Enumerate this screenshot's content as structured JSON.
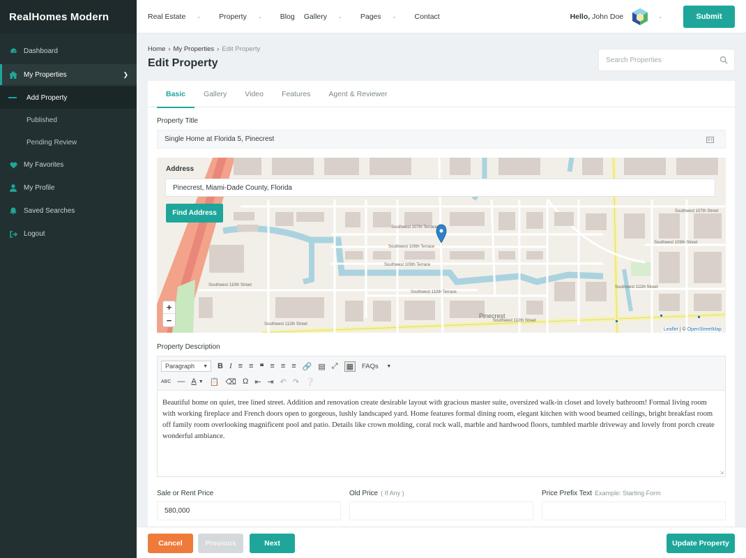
{
  "brand": "RealHomes Modern",
  "sidebar": {
    "items": [
      {
        "label": "Dashboard",
        "icon": "dashboard-icon"
      },
      {
        "label": "My Properties",
        "icon": "home-icon"
      },
      {
        "label": "My Favorites",
        "icon": "heart-icon"
      },
      {
        "label": "My Profile",
        "icon": "user-icon"
      },
      {
        "label": "Saved Searches",
        "icon": "bell-icon"
      },
      {
        "label": "Logout",
        "icon": "logout-icon"
      }
    ],
    "subitems": [
      "Add Property",
      "Published",
      "Pending Review"
    ]
  },
  "header": {
    "nav": [
      "Real Estate",
      "Property",
      "Blog",
      "Gallery",
      "Pages",
      "Contact"
    ],
    "hello": "Hello,",
    "username": "John Doe",
    "submit": "Submit"
  },
  "breadcrumb": [
    "Home",
    "My Properties",
    "Edit Property"
  ],
  "page_title": "Edit Property",
  "search": {
    "placeholder": "Search Properties"
  },
  "tabs": [
    "Basic",
    "Gallery",
    "Video",
    "Features",
    "Agent & Reviewer"
  ],
  "form": {
    "title_label": "Property Title",
    "title_value": "Single Home at Florida 5, Pinecrest",
    "address_label": "Address",
    "address_value": "Pinecrest, Miami-Dade County, Florida",
    "find_address": "Find Address",
    "description_label": "Property Description",
    "description": "Beautiful home on quiet, tree lined street. Addition and renovation create desirable layout with gracious master suite, oversized walk-in closet and lovely bathroom! Formal living room with working fireplace and French doors open to gorgeous, lushly landscaped yard. Home features formal dining room, elegant kitchen with wood beamed ceilings, bright breakfast room off family room overlooking magnificent pool and patio. Details like crown molding, coral rock wall, marble and hardwood floors, tumbled marble driveway and lovely front porch create wonderful ambiance.",
    "editor_paragraph": "Paragraph",
    "editor_faqs": "FAQs",
    "sale_price_label": "Sale or Rent Price",
    "sale_price_value": "580,000",
    "old_price_label": "Old Price",
    "old_price_hint": "( If Any )",
    "prefix_label": "Price Prefix Text",
    "prefix_hint": "Example: Starting Form"
  },
  "map": {
    "attribution_leaflet": "Leaflet",
    "attribution_sep": " | © ",
    "attribution_osm": "OpenStreetMap",
    "place": "Pinecrest",
    "streets": [
      "Southwest 107th Terrace",
      "Southwest 108th Terrace",
      "Southwest 109th Terrace",
      "Southwest 110th Street",
      "Southwest 110th Terrace",
      "Southwest 111th Street",
      "Southwest 112th Street",
      "Southwest 107th Street",
      "Southwest 109th Street"
    ]
  },
  "footer": {
    "cancel": "Cancel",
    "previous": "Previous",
    "next": "Next",
    "update": "Update Property"
  },
  "colors": {
    "accent": "#1ea69a",
    "cancel": "#ef7b3a",
    "sidebar": "#233031"
  }
}
